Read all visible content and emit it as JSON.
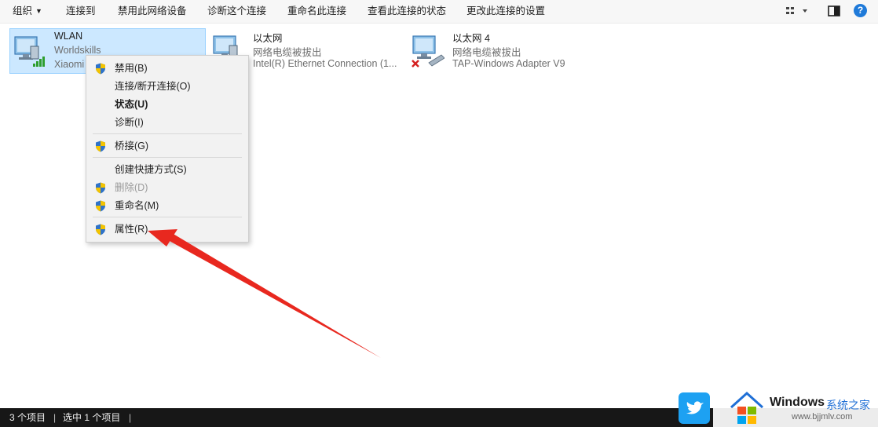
{
  "toolbar": {
    "organize": "组织",
    "connect_to": "连接到",
    "disable_device": "禁用此网络设备",
    "diagnose": "诊断这个连接",
    "rename": "重命名此连接",
    "view_status": "查看此连接的状态",
    "change_settings": "更改此连接的设置",
    "help": "?"
  },
  "connections": [
    {
      "name": "WLAN",
      "line2": "Worldskills",
      "line3": "Xiaomi"
    },
    {
      "name": "以太网",
      "line2": "网络电缆被拔出",
      "line3": "Intel(R) Ethernet Connection (1..."
    },
    {
      "name": "以太网 4",
      "line2": "网络电缆被拔出",
      "line3": "TAP-Windows Adapter V9"
    }
  ],
  "context_menu": {
    "items": [
      {
        "label": "禁用(B)"
      },
      {
        "label": "连接/断开连接(O)"
      },
      {
        "label": "状态(U)"
      },
      {
        "label": "诊断(I)"
      },
      {
        "label": "桥接(G)"
      },
      {
        "label": "创建快捷方式(S)"
      },
      {
        "label": "删除(D)"
      },
      {
        "label": "重命名(M)"
      },
      {
        "label": "属性(R)"
      }
    ]
  },
  "status_bar": {
    "item_count": "3 个项目",
    "selected": "选中 1 个项目"
  },
  "watermark": {
    "brand": "Windows",
    "suffix": "系统之家",
    "url": "www.bjjmlv.com"
  },
  "colors": {
    "selection": "#cce8ff",
    "annotation_arrow": "#e8281f",
    "help_icon": "#1f7ad9"
  }
}
